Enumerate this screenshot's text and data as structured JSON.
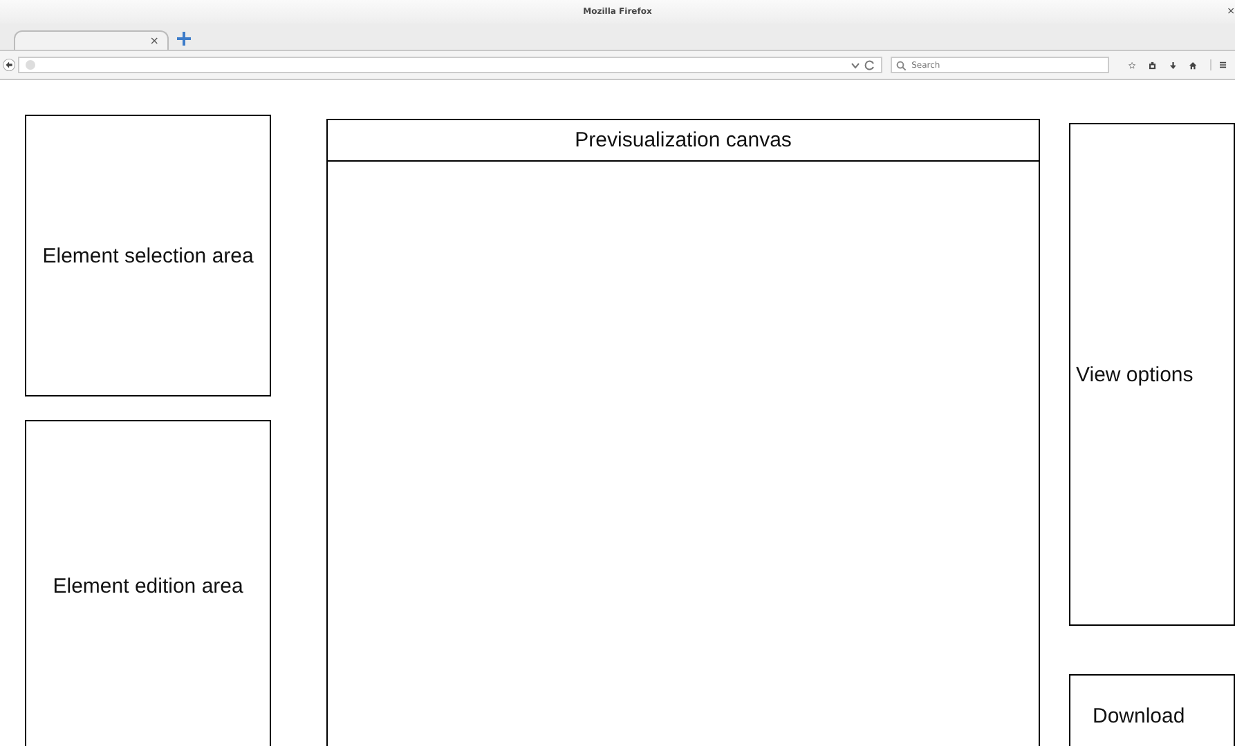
{
  "window": {
    "title": "Mozilla Firefox",
    "close": "×"
  },
  "tabs": [
    {
      "close": "×",
      "selected": true
    }
  ],
  "toolbar": {
    "search": {
      "placeholder": "Search"
    }
  },
  "page": {
    "element_selection": "Element selection area",
    "element_edition": "Element edition area",
    "canvas_title": "Previsualization canvas",
    "view_options": "View options",
    "download": "Download"
  }
}
